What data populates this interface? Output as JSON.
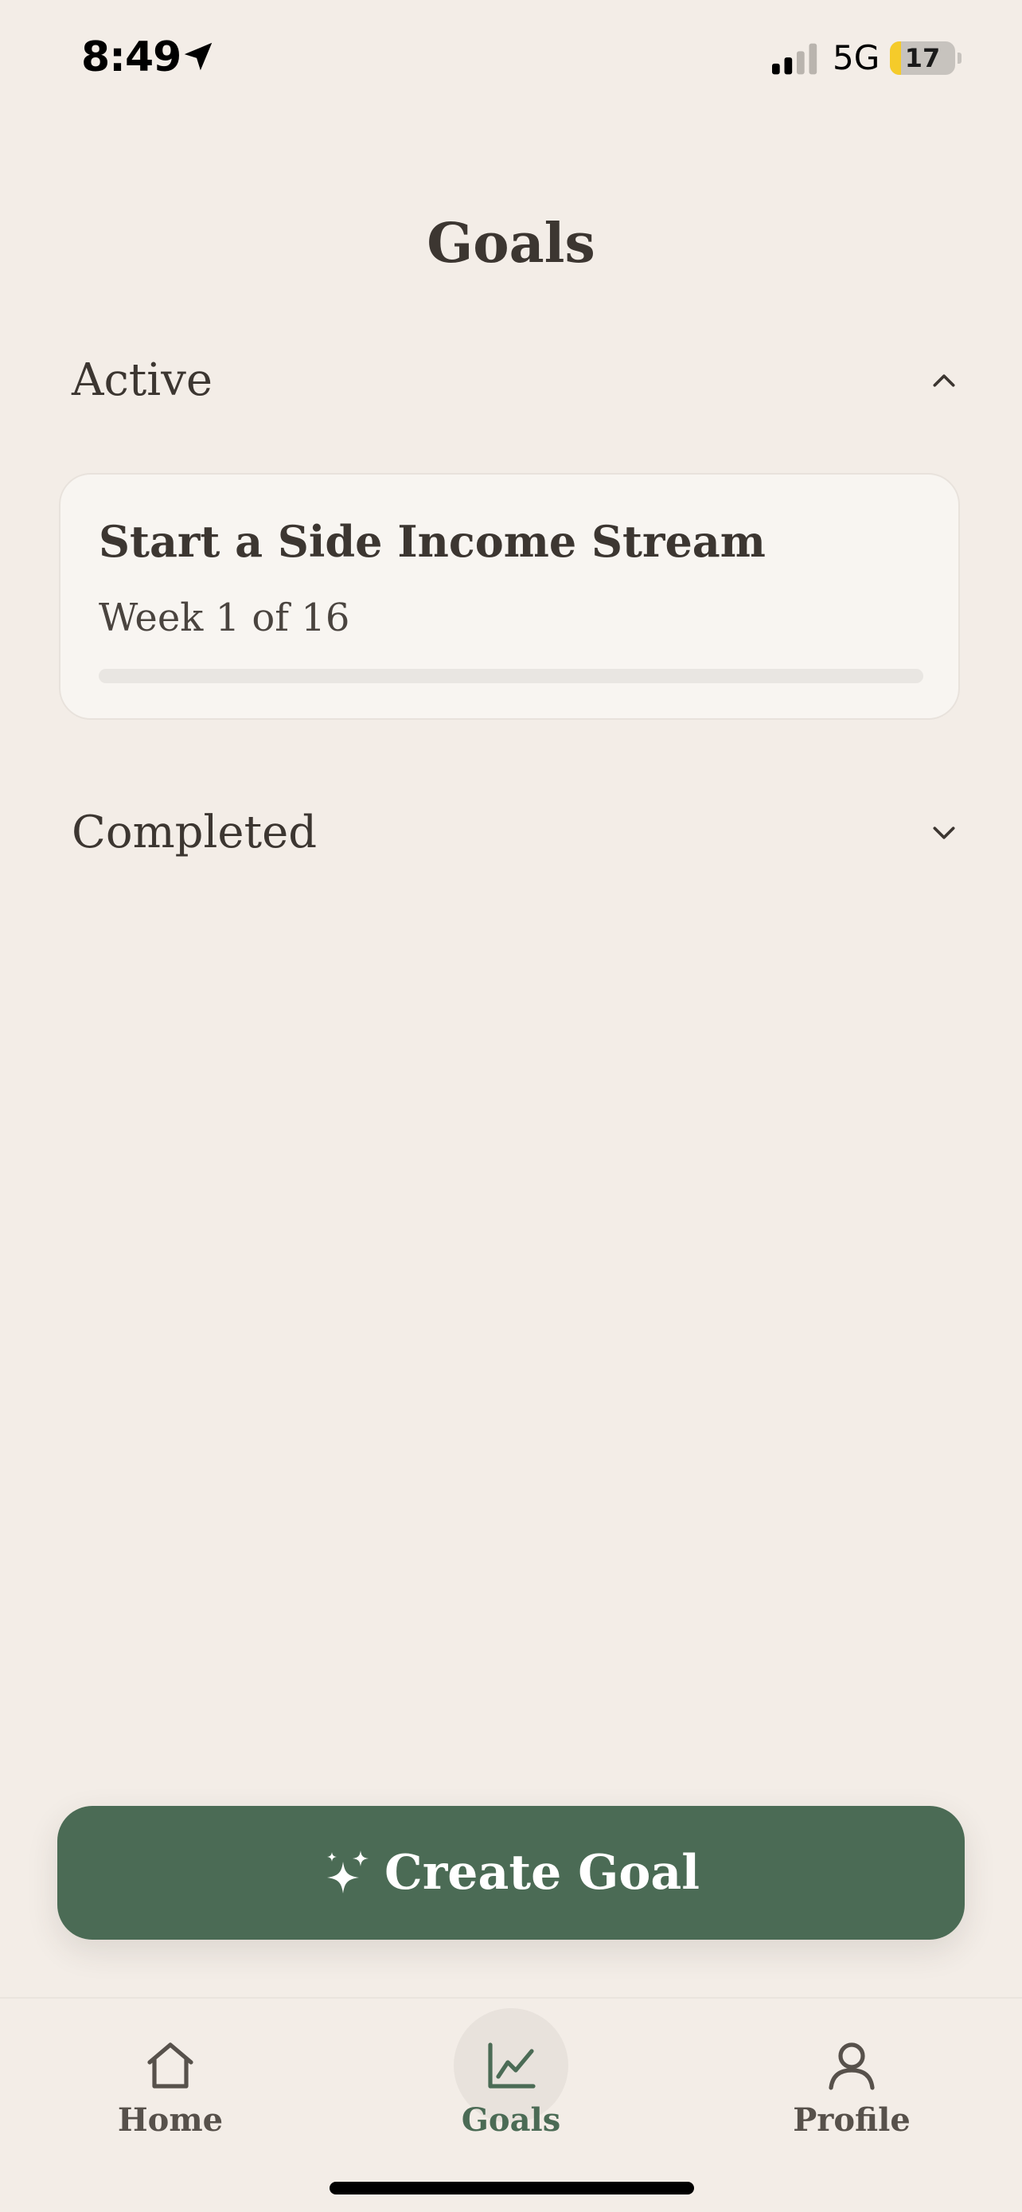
{
  "status_bar": {
    "time": "8:49",
    "network": "5G",
    "battery_level": "17",
    "battery_fraction": 0.17,
    "location_icon": "location-arrow-icon",
    "signal_icon": "cellular-signal-icon"
  },
  "page": {
    "title": "Goals"
  },
  "sections": {
    "active": {
      "label": "Active",
      "expanded": true,
      "chevron_icon": "chevron-up-icon",
      "goals": [
        {
          "title": "Start a Side Income Stream",
          "progress_text": "Week 1 of 16",
          "progress": 0.0
        }
      ]
    },
    "completed": {
      "label": "Completed",
      "expanded": false,
      "chevron_icon": "chevron-down-icon"
    }
  },
  "create_button": {
    "label": "Create Goal",
    "icon": "sparkle-icon"
  },
  "tab_bar": {
    "items": [
      {
        "label": "Home",
        "icon": "home-icon",
        "active": false
      },
      {
        "label": "Goals",
        "icon": "chart-line-icon",
        "active": true
      },
      {
        "label": "Profile",
        "icon": "person-icon",
        "active": false
      }
    ]
  },
  "colors": {
    "background": "#F3EDE7",
    "card": "#F8F5F1",
    "accent": "#4B6B55",
    "text": "#3C3631",
    "battery_fill": "#F5CB2A"
  }
}
